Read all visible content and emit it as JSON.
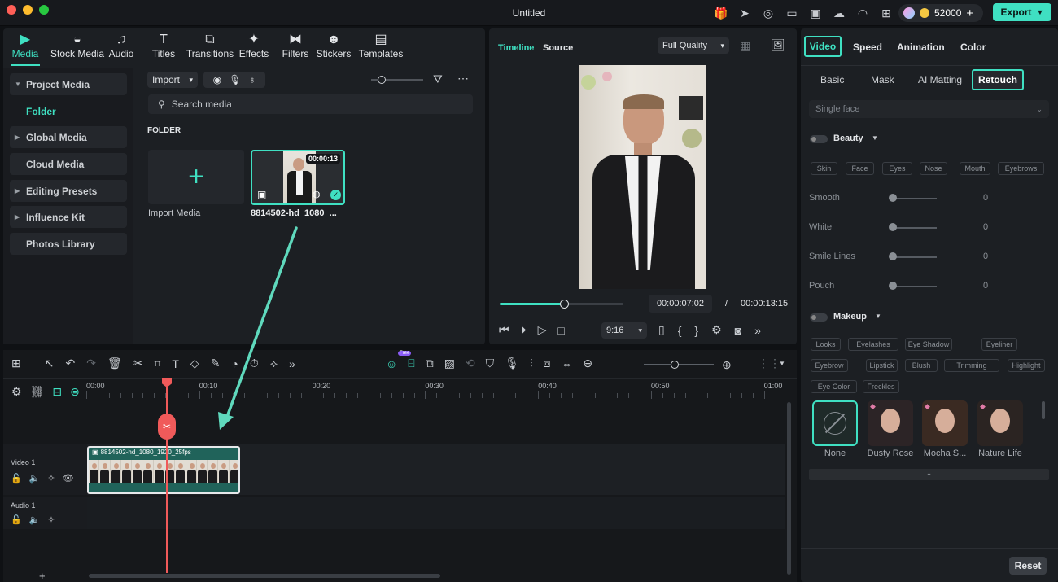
{
  "window": {
    "title": "Untitled"
  },
  "topbar": {
    "credits": "52000",
    "export_label": "Export"
  },
  "media_tabs": [
    {
      "label": "Media",
      "icon": "media-icon"
    },
    {
      "label": "Stock Media",
      "icon": "stock-icon"
    },
    {
      "label": "Audio",
      "icon": "audio-icon"
    },
    {
      "label": "Titles",
      "icon": "titles-icon"
    },
    {
      "label": "Transitions",
      "icon": "transitions-icon"
    },
    {
      "label": "Effects",
      "icon": "effects-icon"
    },
    {
      "label": "Filters",
      "icon": "filters-icon"
    },
    {
      "label": "Stickers",
      "icon": "stickers-icon"
    },
    {
      "label": "Templates",
      "icon": "templates-icon"
    }
  ],
  "sidebar": {
    "items": [
      {
        "label": "Project Media"
      },
      {
        "label": "Folder"
      },
      {
        "label": "Global Media"
      },
      {
        "label": "Cloud Media"
      },
      {
        "label": "Editing Presets"
      },
      {
        "label": "Influence Kit"
      },
      {
        "label": "Photos Library"
      }
    ]
  },
  "media": {
    "import_label": "Import",
    "search_placeholder": "Search media",
    "folder_heading": "FOLDER",
    "import_media_label": "Import Media",
    "clip_name": "8814502-hd_1080_...",
    "clip_duration": "00:00:13"
  },
  "preview": {
    "tab_timeline": "Timeline",
    "tab_source": "Source",
    "quality": "Full Quality",
    "current_time": "00:00:07:02",
    "separator": "/",
    "total_time": "00:00:13:15",
    "aspect": "9:16",
    "progress": 0.52
  },
  "props": {
    "tabs": [
      "Video",
      "Speed",
      "Animation",
      "Color"
    ],
    "subtabs": [
      "Basic",
      "Mask",
      "AI Matting",
      "Retouch"
    ],
    "face_mode": "Single face",
    "beauty_label": "Beauty",
    "beauty_chips": [
      "Skin",
      "Face",
      "Eyes",
      "Nose",
      "Mouth",
      "Eyebrows"
    ],
    "sliders": [
      {
        "label": "Smooth",
        "value": "0"
      },
      {
        "label": "White",
        "value": "0"
      },
      {
        "label": "Smile Lines",
        "value": "0"
      },
      {
        "label": "Pouch",
        "value": "0"
      }
    ],
    "makeup_label": "Makeup",
    "makeup_chips_row1": [
      "Looks",
      "Eyelashes",
      "Eye Shadow",
      "Eyeliner"
    ],
    "makeup_chips_row2": [
      "Eyebrow",
      "Lipstick",
      "Blush",
      "Trimming",
      "Highlight"
    ],
    "makeup_chips_row3": [
      "Eye Color",
      "Freckles"
    ],
    "looks": [
      "None",
      "Dusty Rose",
      "Mocha S...",
      "Nature Life"
    ],
    "reset_label": "Reset"
  },
  "timeline": {
    "ruler": [
      "00:00",
      "00:10",
      "00:20",
      "00:30",
      "00:40",
      "00:50",
      "01:00"
    ],
    "tracks": [
      {
        "name": "Video 1"
      },
      {
        "name": "Audio 1"
      }
    ],
    "clip_label": "8814502-hd_1080_1920_25fps",
    "free_badge": "Free"
  },
  "colors": {
    "accent": "#3fe0c2",
    "playhead": "#f05a5a"
  }
}
